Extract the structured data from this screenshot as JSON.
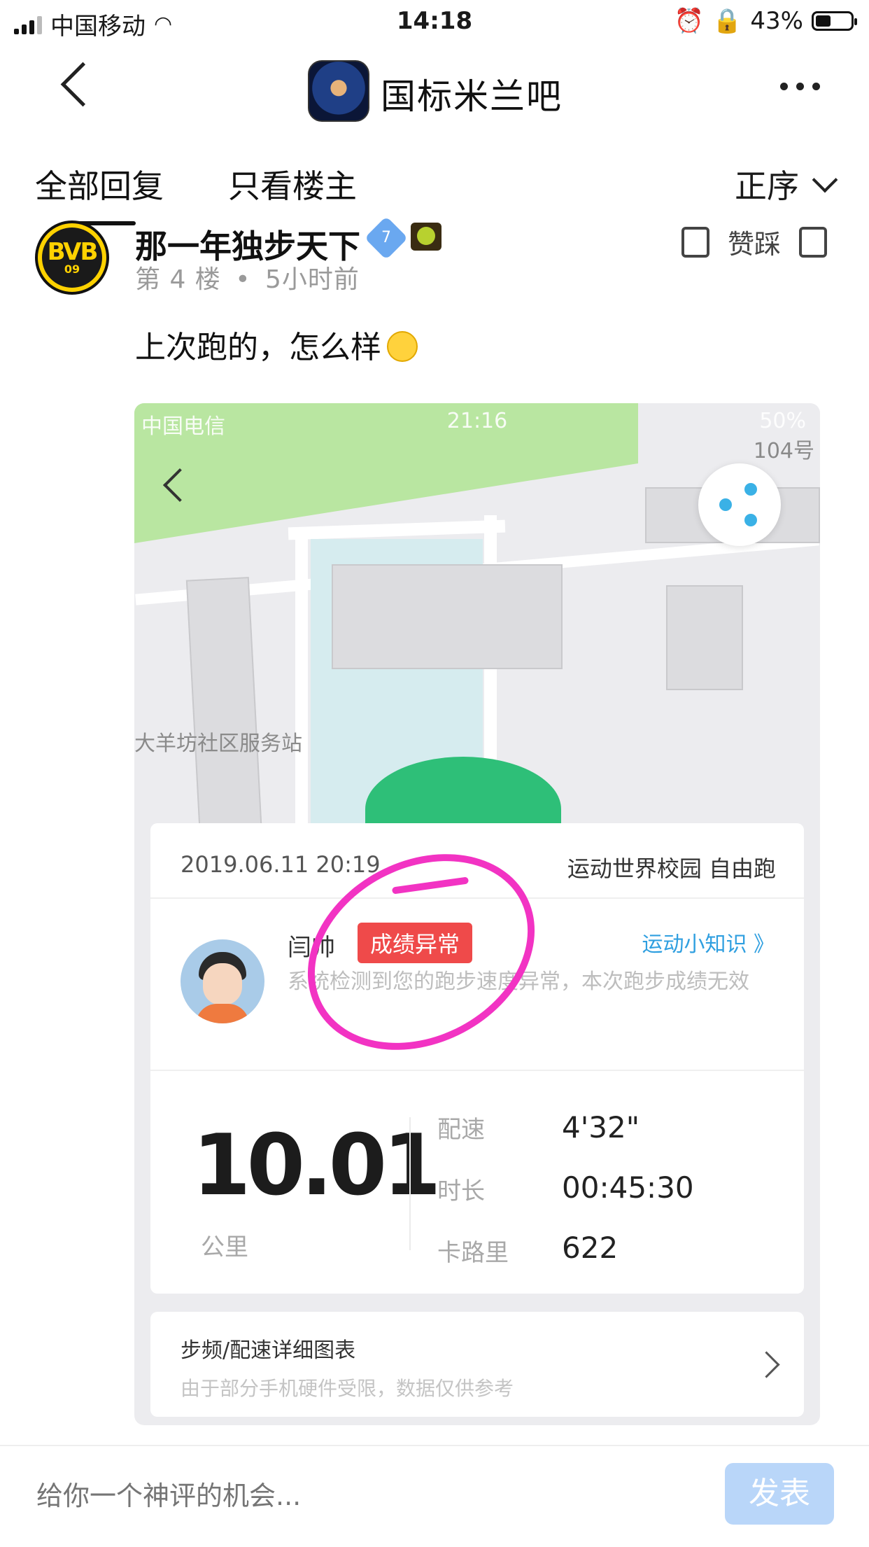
{
  "status_bar": {
    "carrier": "中国移动",
    "time": "14:18",
    "battery_percent": "43%",
    "battery_level": 0.43
  },
  "nav": {
    "title": "国标米兰吧"
  },
  "tabs": {
    "all_replies": "全部回复",
    "only_op": "只看楼主",
    "sort": "正序"
  },
  "post": {
    "username": "那一年独步天下",
    "level": "7",
    "floor": "第 4 楼",
    "separator": "•",
    "time_ago": "5小时前",
    "likes_label": "赞踩",
    "avatar_text": "BVB",
    "avatar_sub": "09",
    "content": "上次跑的，怎么样"
  },
  "embedded": {
    "status_carrier": "中国电信",
    "status_time": "21:16",
    "status_battery": "50%",
    "map_label_1": "大羊坊社区服务站",
    "map_label_2": "104号",
    "card": {
      "date": "2019.06.11 20:19",
      "mode": "运动世界校园 自由跑",
      "name": "闫帅",
      "badge": "成绩异常",
      "link": "运动小知识 》",
      "desc": "系统检测到您的跑步速度异常，本次跑步成绩无效",
      "distance": "10.01",
      "unit": "公里",
      "pace_label": "配速",
      "pace": "4'32\"",
      "duration_label": "时长",
      "duration": "00:45:30",
      "calories_label": "卡路里",
      "calories": "622"
    },
    "chart_card": {
      "title": "步频/配速详细图表",
      "subtitle": "由于部分手机硬件受限，数据仅供参考"
    }
  },
  "reply_bar": {
    "placeholder": "给你一个神评的机会...",
    "publish": "发表"
  },
  "colors": {
    "accent_blue": "#2f9fe0",
    "badge_red": "#ef4a4a",
    "annotation_pink": "#f233c3",
    "publish_button": "#b9d6f9"
  }
}
